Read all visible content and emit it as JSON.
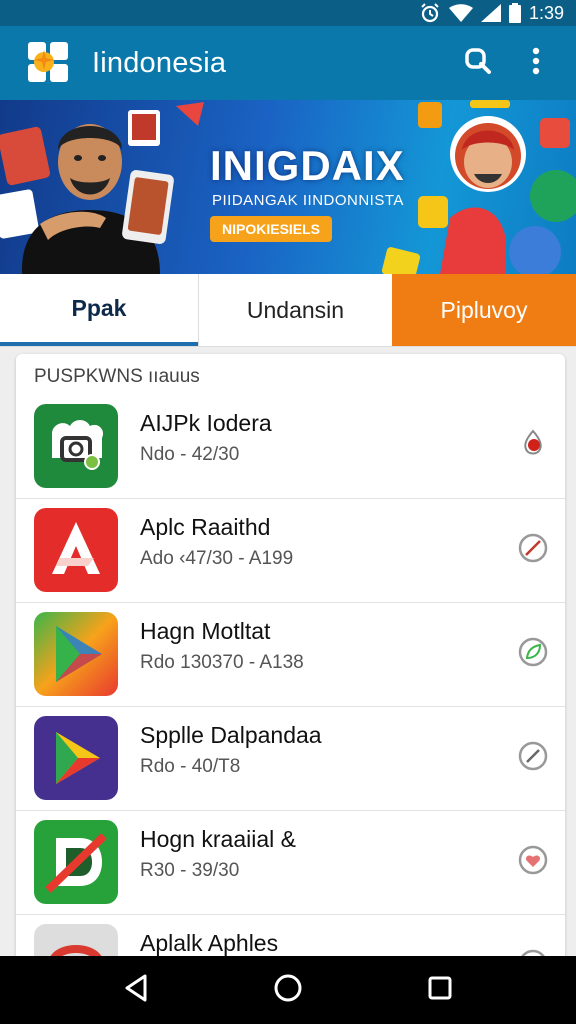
{
  "status_bar": {
    "time": "1:39"
  },
  "app_bar": {
    "title": "Iindonesia"
  },
  "banner": {
    "title": "INIGDAIX",
    "subtitle": "PIIDANGAK IINDONNISTA",
    "badge": "NIPOKIESIELS"
  },
  "tabs": [
    {
      "label": "Ppak",
      "selected": true
    },
    {
      "label": "Undansin",
      "selected": false
    },
    {
      "label": "Pipluvoy",
      "selected": false
    }
  ],
  "list": {
    "header": "PUSPKWNS ııauus",
    "items": [
      {
        "name": "AIJPk Iodera",
        "meta": "Ndo - 42/30",
        "icon": "camera-app-icon",
        "action_icon": "map-pin-icon"
      },
      {
        "name": "Aplc Raaithd",
        "meta": "Ado ‹47/30 - A199",
        "icon": "red-a-app-icon",
        "action_icon": "slash-circle-icon"
      },
      {
        "name": "Hagn Motltat",
        "meta": "Rdo 130370 - A138",
        "icon": "play-triangle-app-icon",
        "action_icon": "leaf-circle-icon"
      },
      {
        "name": "Spplle Dalpandaa",
        "meta": "Rdo - 40/T8",
        "icon": "purple-play-app-icon",
        "action_icon": "slash-circle-icon"
      },
      {
        "name": "Hogn kraaiial &",
        "meta": "R30 - 39/30",
        "icon": "green-d-app-icon",
        "action_icon": "heart-circle-icon"
      },
      {
        "name": "Aplalk Aphles",
        "meta": "",
        "icon": "gray-app-icon",
        "action_icon": "circle-icon"
      }
    ]
  },
  "colors": {
    "app_bar": "#0a78ab",
    "status_bar": "#0b5f87",
    "tab_accent": "#f07d14",
    "tab_indicator": "#1d6fb0"
  }
}
